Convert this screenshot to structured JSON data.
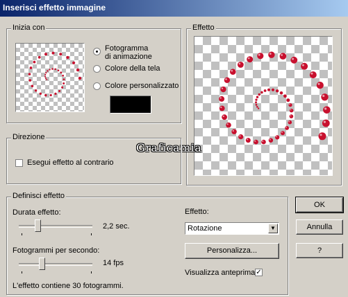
{
  "window": {
    "title": "Inserisci effetto immagine"
  },
  "start_group": {
    "label": "Inizia con",
    "options": [
      {
        "label": "Fotogramma\ndi animazione",
        "selected": true
      },
      {
        "label": "Colore della tela",
        "selected": false
      },
      {
        "label": "Colore personalizzato",
        "selected": false
      }
    ],
    "option_1_line1": "Fotogramma",
    "option_1_line2": "di animazione",
    "custom_color": "#000000"
  },
  "direction_group": {
    "label": "Direzione",
    "reverse_label": "Esegui effetto al contrario",
    "reverse_checked": false
  },
  "effect_preview": {
    "label": "Effetto"
  },
  "define_group": {
    "label": "Definisci effetto",
    "duration_label": "Durata effetto:",
    "duration_value": "2,2 sec.",
    "fps_label": "Fotogrammi per secondo:",
    "fps_value": "14 fps",
    "frames_info": "L'effetto contiene 30 fotogrammi.",
    "effect_label": "Effetto:",
    "effect_selected": "Rotazione",
    "customize_label": "Personalizza...",
    "preview_label": "Visualizza anteprima",
    "preview_checked": true
  },
  "buttons": {
    "ok": "OK",
    "cancel": "Annulla",
    "help": "?"
  },
  "watermark": "Graficamia",
  "colors": {
    "title_start": "#0a246a",
    "title_end": "#a6caf0",
    "dot": "#c8102e",
    "face": "#d4d0c8"
  }
}
